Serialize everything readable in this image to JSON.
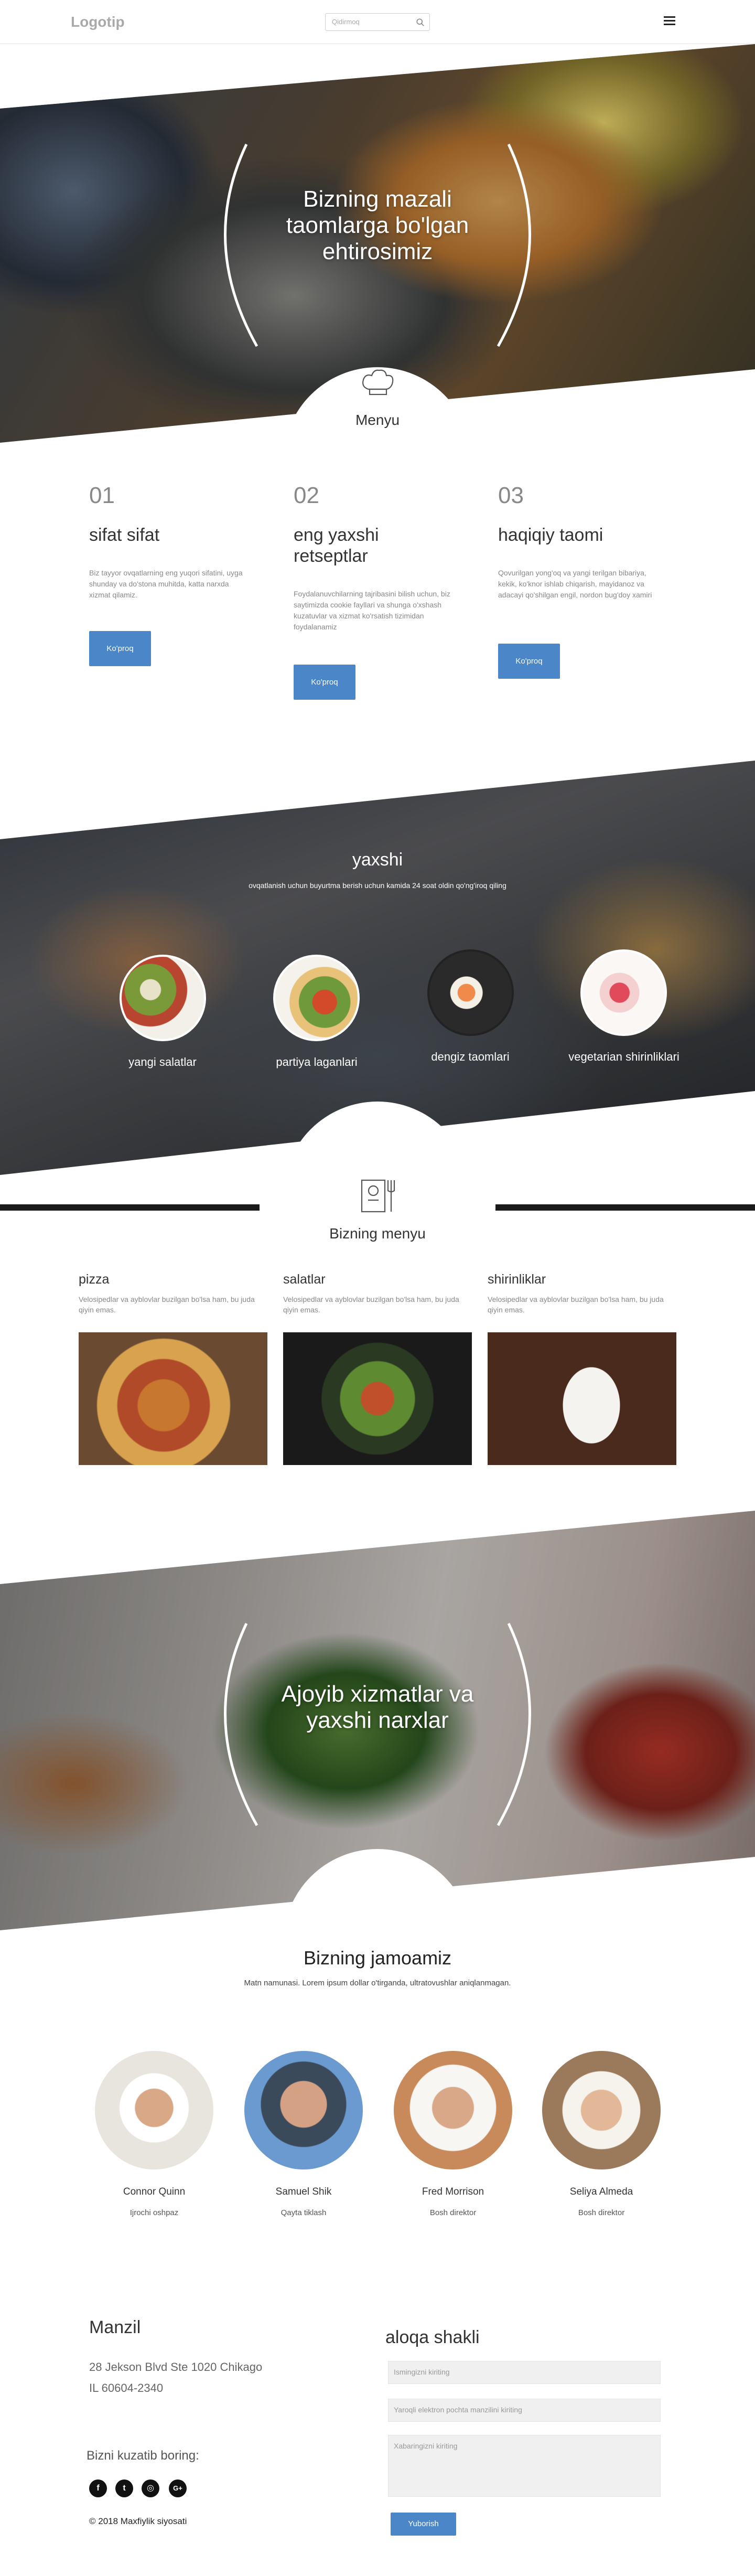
{
  "header": {
    "logo": "Logotip",
    "search_placeholder": "Qidirmoq"
  },
  "hero1": {
    "title": "Bizning mazali taomlarga bo'lgan ehtirosimiz"
  },
  "menu_tab": {
    "label": "Menyu"
  },
  "steps": [
    {
      "num": "01",
      "title": "sifat sifat",
      "text": "Biz tayyor ovqatlarning eng yuqori sifatini, uyga shunday va do'stona muhitda, katta narxda xizmat qilamiz.",
      "button": "Ko'proq"
    },
    {
      "num": "02",
      "title": "eng yaxshi retseptlar",
      "text": "Foydalanuvchilarning tajribasini bilish uchun, biz saytimizda cookie fayllari va shunga o'xshash kuzatuvlar va xizmat ko'rsatish tizimidan foydalanamiz",
      "button": "Ko'proq"
    },
    {
      "num": "03",
      "title": "haqiqiy taomi",
      "text": "Qovurilgan yong'oq va yangi terilgan bibariya, kekik, ko'knor ishlab chiqarish, mayidanoz va adacayi qo'shilgan engil, nordon bug'doy xamiri",
      "button": "Ko'proq"
    }
  ],
  "yaxshi": {
    "title": "yaxshi",
    "subtitle": "ovqatlanish uchun buyurtma berish uchun kamida 24 soat oldin qo'ng'iroq qiling",
    "categories": [
      "yangi salatlar",
      "partiya laganlari",
      "dengiz taomlari",
      "vegetarian shirinliklari"
    ]
  },
  "our_menu": {
    "title": "Bizning menyu",
    "items": [
      {
        "title": "pizza",
        "text": "Velosipedlar va ayblovlar buzilgan bo'lsa ham, bu juda qiyin emas."
      },
      {
        "title": "salatlar",
        "text": "Velosipedlar va ayblovlar buzilgan bo'lsa ham, bu juda qiyin emas."
      },
      {
        "title": "shirinliklar",
        "text": "Velosipedlar va ayblovlar buzilgan bo'lsa ham, bu juda qiyin emas."
      }
    ]
  },
  "hero3": {
    "title": "Ajoyib xizmatlar va yaxshi narxlar"
  },
  "team": {
    "title": "Bizning jamoamiz",
    "subtitle": "Matn namunasi. Lorem ipsum dollar o'tirganda, ultratovushlar aniqlanmagan.",
    "members": [
      {
        "name": "Connor Quinn",
        "role": "Ijrochi oshpaz"
      },
      {
        "name": "Samuel Shik",
        "role": "Qayta tiklash"
      },
      {
        "name": "Fred Morrison",
        "role": "Bosh direktor"
      },
      {
        "name": "Seliya Almeda",
        "role": "Bosh direktor"
      }
    ]
  },
  "footer": {
    "address_title": "Manzil",
    "address_line1": "28 Jekson Blvd Ste 1020 Chikago",
    "address_line2": "IL 60604-2340",
    "follow": "Bizni kuzatib boring:",
    "social_icons": [
      "facebook-icon",
      "twitter-icon",
      "instagram-icon",
      "google-plus-icon"
    ],
    "copyright": "© 2018 Maxfiylik siyosati",
    "contact_title": "aloqa shakli",
    "name_placeholder": "Ismingizni kiriting",
    "email_placeholder": "Yaroqli elektron pochta manzilini kiriting",
    "message_placeholder": "Xabaringizni kiriting",
    "submit": "Yuborish"
  },
  "colors": {
    "accent": "#4a86c8",
    "text_dark": "#333333",
    "text_muted": "#888888"
  }
}
